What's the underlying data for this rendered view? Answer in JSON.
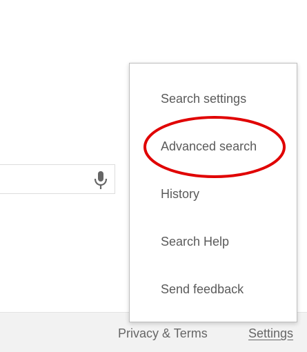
{
  "search": {
    "mic_icon": "microphone-icon"
  },
  "menu": {
    "items": [
      {
        "label": "Search settings"
      },
      {
        "label": "Advanced search"
      },
      {
        "label": "History"
      },
      {
        "label": "Search Help"
      },
      {
        "label": "Send feedback"
      }
    ]
  },
  "footer": {
    "privacy_label": "Privacy & Terms",
    "settings_label": "Settings"
  },
  "annotation": {
    "color": "#e00000",
    "highlighted_item": "Advanced search"
  }
}
